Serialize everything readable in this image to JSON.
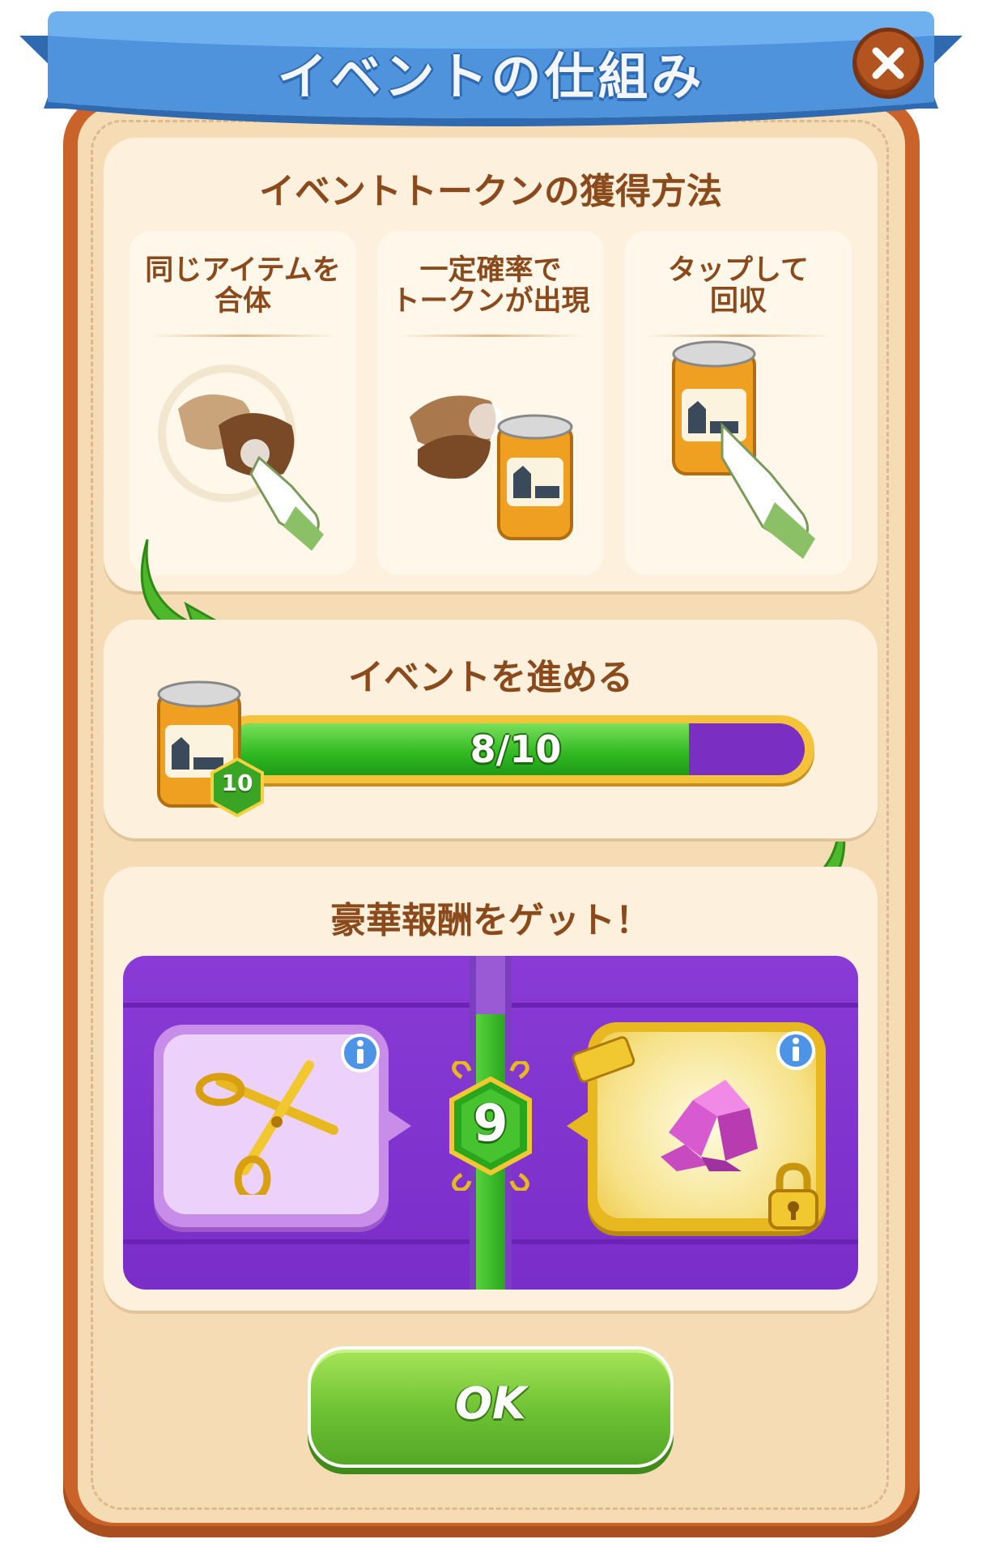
{
  "header": {
    "title": "イベントの仕組み",
    "close_icon": "close-icon"
  },
  "section1": {
    "title": "イベントトークンの獲得方法",
    "steps": [
      {
        "label_line1": "同じアイテムを",
        "label_line2": "合体",
        "icon": "gloves-merge-icon"
      },
      {
        "label_line1": "一定確率で",
        "label_line2": "トークンが出現",
        "icon": "token-appear-icon"
      },
      {
        "label_line1": "タップして",
        "label_line2": "回収",
        "icon": "tap-collect-icon"
      }
    ]
  },
  "section2": {
    "title": "イベントを進める",
    "progress_text": "8/10",
    "progress_fraction": 0.8,
    "token_badge": "10"
  },
  "section3": {
    "title": "豪華報酬をゲット！",
    "level": "9",
    "left_reward_icon": "scissors-icon",
    "right_reward_icon": "gem-pile-icon",
    "info_icon": "info-icon",
    "lock_icon": "lock-icon"
  },
  "footer": {
    "ok_label": "OK"
  },
  "colors": {
    "frame": "#c9632a",
    "panel": "#f6dcb4",
    "accent_green": "#6cc132",
    "purple": "#7a2dc8",
    "title_brown": "#8a4a1c"
  }
}
